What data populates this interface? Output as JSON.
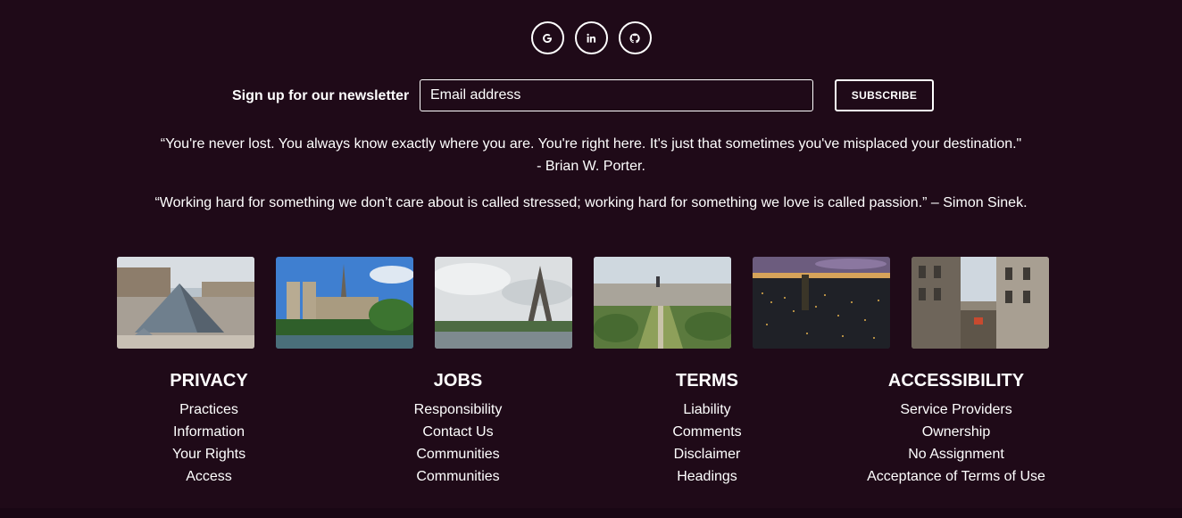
{
  "social": [
    {
      "icon": "google-icon",
      "glyph": "G"
    },
    {
      "icon": "linkedin-icon",
      "glyph": "in"
    },
    {
      "icon": "github-icon",
      "glyph": ""
    }
  ],
  "newsletter": {
    "label": "Sign up for our newsletter",
    "placeholder": "Email address",
    "button": "SUBSCRIBE"
  },
  "quotes": [
    {
      "line1": "“You're never lost. You always know exactly where you are. You're right here. It's just that sometimes you've misplaced your destination.\"",
      "line2": "- Brian W. Porter."
    },
    {
      "line1": "“Working hard for something we don’t care about is called stressed; working hard for something we love is called passion.” – Simon Sinek."
    }
  ],
  "gallery": [
    {
      "name": "louvre-pyramid"
    },
    {
      "name": "notre-dame"
    },
    {
      "name": "eiffel-tower"
    },
    {
      "name": "paris-aerial"
    },
    {
      "name": "city-skyline-night"
    },
    {
      "name": "paris-street"
    }
  ],
  "columns": [
    {
      "title": "PRIVACY",
      "links": [
        "Practices",
        "Information",
        "Your Rights",
        "Access"
      ]
    },
    {
      "title": "JOBS",
      "links": [
        "Responsibility",
        "Contact Us",
        "Communities",
        "Communities"
      ]
    },
    {
      "title": "TERMS",
      "links": [
        "Liability",
        "Comments",
        "Disclaimer",
        "Headings"
      ]
    },
    {
      "title": "ACCESSIBILITY",
      "links": [
        "Service Providers",
        "Ownership",
        "No Assignment",
        "Acceptance of Terms of Use"
      ]
    }
  ]
}
